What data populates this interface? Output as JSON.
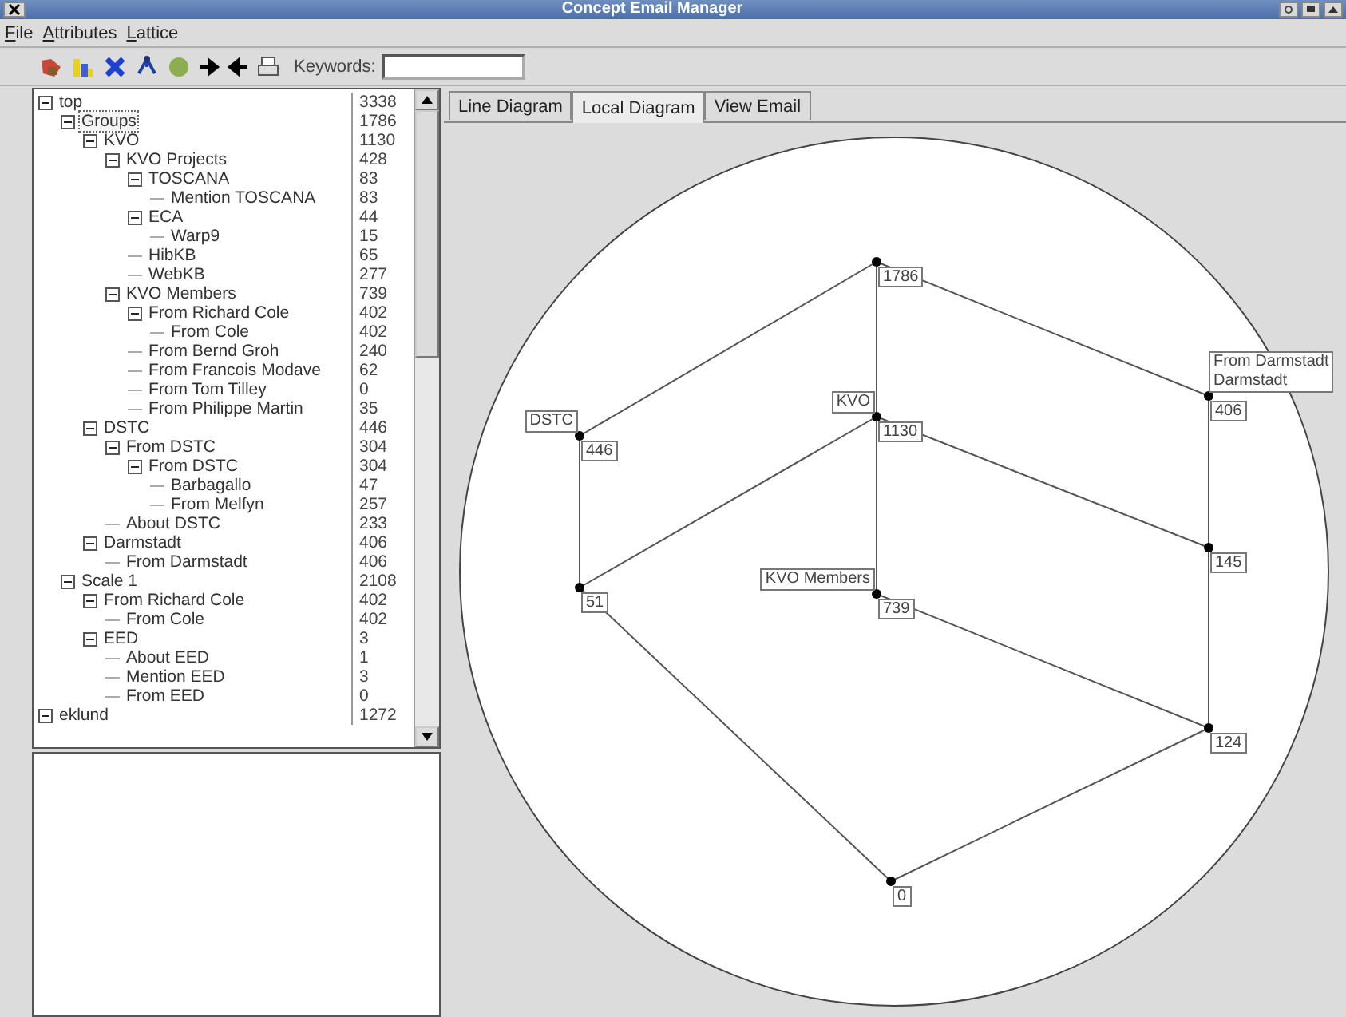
{
  "window": {
    "title": "Concept Email Manager"
  },
  "menu": [
    "File",
    "Attributes",
    "Lattice"
  ],
  "toolbar": {
    "keywords_label": "Keywords:"
  },
  "tree": {
    "items": [
      {
        "label": "top",
        "count": "3338",
        "expanded": true,
        "selected": false,
        "children": [
          {
            "label": "Groups",
            "count": "1786",
            "expanded": true,
            "selected": true,
            "children": [
              {
                "label": "KVO",
                "count": "1130",
                "expanded": true,
                "selected": false,
                "children": [
                  {
                    "label": "KVO Projects",
                    "count": "428",
                    "expanded": true,
                    "selected": false,
                    "children": [
                      {
                        "label": "TOSCANA",
                        "count": "83",
                        "expanded": true,
                        "selected": false,
                        "children": [
                          {
                            "label": "Mention TOSCANA",
                            "count": "83",
                            "selected": false
                          }
                        ]
                      },
                      {
                        "label": "ECA",
                        "count": "44",
                        "expanded": true,
                        "selected": false,
                        "children": [
                          {
                            "label": "Warp9",
                            "count": "15",
                            "selected": false
                          }
                        ]
                      },
                      {
                        "label": "HibKB",
                        "count": "65",
                        "selected": false
                      },
                      {
                        "label": "WebKB",
                        "count": "277",
                        "selected": false
                      }
                    ]
                  },
                  {
                    "label": "KVO Members",
                    "count": "739",
                    "expanded": true,
                    "selected": false,
                    "children": [
                      {
                        "label": "From Richard Cole",
                        "count": "402",
                        "expanded": true,
                        "selected": false,
                        "children": [
                          {
                            "label": "From Cole",
                            "count": "402",
                            "selected": false
                          }
                        ]
                      },
                      {
                        "label": "From Bernd Groh",
                        "count": "240",
                        "selected": false
                      },
                      {
                        "label": "From Francois Modave",
                        "count": "62",
                        "selected": false
                      },
                      {
                        "label": "From Tom Tilley",
                        "count": "0",
                        "selected": false
                      },
                      {
                        "label": "From Philippe Martin",
                        "count": "35",
                        "selected": false
                      }
                    ]
                  }
                ]
              },
              {
                "label": "DSTC",
                "count": "446",
                "expanded": true,
                "selected": false,
                "children": [
                  {
                    "label": "From DSTC",
                    "count": "304",
                    "expanded": true,
                    "selected": false,
                    "children": [
                      {
                        "label": "From DSTC",
                        "count": "304",
                        "expanded": true,
                        "selected": false,
                        "children": [
                          {
                            "label": "Barbagallo",
                            "count": "47",
                            "selected": false
                          },
                          {
                            "label": "From Melfyn",
                            "count": "257",
                            "selected": false
                          }
                        ]
                      }
                    ]
                  },
                  {
                    "label": "About DSTC",
                    "count": "233",
                    "selected": false
                  }
                ]
              },
              {
                "label": "Darmstadt",
                "count": "406",
                "expanded": true,
                "selected": false,
                "children": [
                  {
                    "label": "From Darmstadt",
                    "count": "406",
                    "selected": false
                  }
                ]
              }
            ]
          },
          {
            "label": "Scale 1",
            "count": "2108",
            "expanded": true,
            "selected": false,
            "children": [
              {
                "label": "From Richard Cole",
                "count": "402",
                "expanded": true,
                "selected": false,
                "children": [
                  {
                    "label": "From Cole",
                    "count": "402",
                    "selected": false
                  }
                ]
              },
              {
                "label": "EED",
                "count": "3",
                "expanded": true,
                "selected": false,
                "children": [
                  {
                    "label": "About EED",
                    "count": "1",
                    "selected": false
                  },
                  {
                    "label": "Mention EED",
                    "count": "3",
                    "selected": false
                  },
                  {
                    "label": "From EED",
                    "count": "0",
                    "selected": false
                  }
                ]
              }
            ]
          }
        ]
      },
      {
        "label": "eklund",
        "count": "1272",
        "expanded": true,
        "selected": false
      }
    ]
  },
  "tabs": [
    {
      "label": "Line Diagram",
      "selected": false
    },
    {
      "label": "Local Diagram",
      "selected": true
    },
    {
      "label": "View Email",
      "selected": false
    }
  ],
  "diagram": {
    "nodes": [
      {
        "count": "1786"
      },
      {
        "count": "1130",
        "labels": [
          "KVO"
        ]
      },
      {
        "count": "446",
        "labels": [
          "DSTC"
        ]
      },
      {
        "count": "51"
      },
      {
        "count": "739",
        "labels": [
          "KVO Members"
        ]
      },
      {
        "count": "406",
        "labels": [
          "From Darmstadt",
          "Darmstadt"
        ]
      },
      {
        "count": "145"
      },
      {
        "count": "124"
      },
      {
        "count": "0"
      }
    ]
  }
}
